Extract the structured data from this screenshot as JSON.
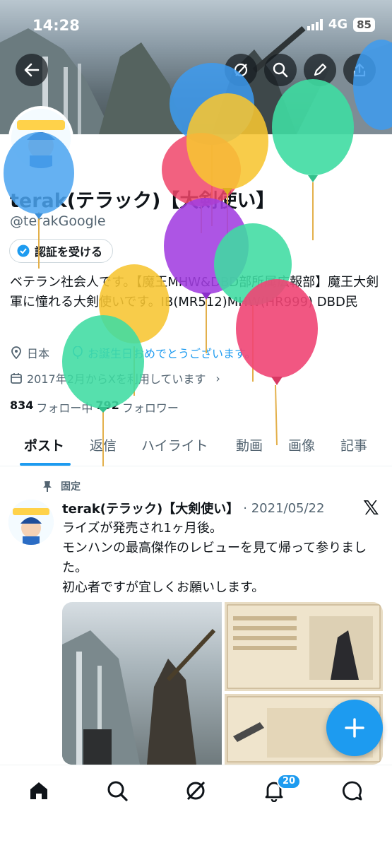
{
  "status_bar": {
    "time": "14:28",
    "network": "4G",
    "battery": "85"
  },
  "profile": {
    "display_name": "terak(テラック)【大剣使い】",
    "handle": "@terakGoogle",
    "verify_label": "認証を受ける",
    "bio": "ベテラン社会人です。【魔王MHW&DBD部所属広報部】魔王大剣軍に憧れる大剣使いです。IB(MR512)MHW(HR999) DBD民",
    "location": "日本",
    "birthday_text": "お誕生日おめでとうございます。",
    "joined": "2017年2月からXを利用しています",
    "following_count": "834",
    "following_label": "フォロー中",
    "followers_count": "792",
    "followers_label": "フォロワー"
  },
  "tabs": [
    {
      "label": "ポスト"
    },
    {
      "label": "返信"
    },
    {
      "label": "ハイライト"
    },
    {
      "label": "動画"
    },
    {
      "label": "画像"
    },
    {
      "label": "記事"
    }
  ],
  "post": {
    "pinned_label": "固定",
    "author_name": "terak(テラック)【大剣使い】",
    "date": "· 2021/05/22",
    "text": "ライズが発売され1ヶ月後。\nモンハンの最高傑作のレビューを見て帰って参りました。\n初心者ですが宜しくお願いします。"
  },
  "notifications": {
    "badge": "20"
  },
  "colors": {
    "accent": "#1d9bf0",
    "text": "#0f1419",
    "secondary": "#536471"
  },
  "icons": [
    "back-icon",
    "search-icon",
    "edit-icon",
    "share-icon",
    "grok-icon",
    "location-icon",
    "balloon-icon",
    "calendar-icon",
    "pin-icon",
    "x-logo-icon",
    "plus-icon",
    "home-icon",
    "notifications-icon",
    "messages-icon"
  ]
}
